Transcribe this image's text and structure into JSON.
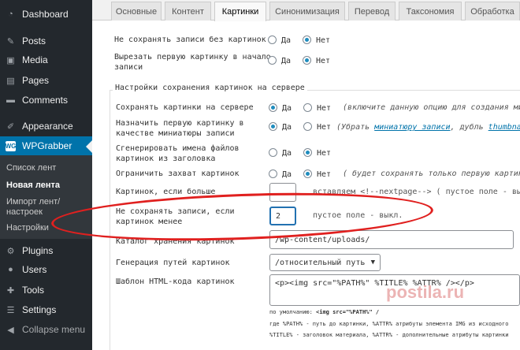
{
  "sidebar": {
    "items": [
      {
        "label": "Dashboard",
        "icon": "dashboard-icon"
      },
      {
        "label": "Posts",
        "icon": "pushpin-icon"
      },
      {
        "label": "Media",
        "icon": "media-icon"
      },
      {
        "label": "Pages",
        "icon": "pages-icon"
      },
      {
        "label": "Comments",
        "icon": "comment-icon"
      },
      {
        "label": "Appearance",
        "icon": "brush-icon"
      },
      {
        "label": "WPGrabber",
        "icon_text": "WG"
      },
      {
        "label": "Plugins",
        "icon": "plugin-icon"
      },
      {
        "label": "Users",
        "icon": "users-icon"
      },
      {
        "label": "Tools",
        "icon": "wrench-icon"
      },
      {
        "label": "Settings",
        "icon": "settings-icon"
      },
      {
        "label": "Collapse menu",
        "icon": "collapse-icon"
      }
    ],
    "submenu": [
      "Список лент",
      "Новая лента",
      "Импорт лент/",
      "настроек",
      "Настройки"
    ]
  },
  "tabs": [
    "Основные",
    "Контент",
    "Картинки",
    "Синонимизация",
    "Перевод",
    "Таксономия",
    "Обработка"
  ],
  "active_tab": "Картинки",
  "radio_labels": {
    "yes": "Да",
    "no": "Нет"
  },
  "top_options": [
    {
      "label": "Не сохранять записи без картинок",
      "value": "Нет"
    },
    {
      "label_1": "Вырезать первую картинку в начало",
      "label_2": "записи",
      "value": "Нет"
    }
  ],
  "section_title": "Настройки сохранения картинок на сервере",
  "server_options": {
    "save": {
      "label": "Сохранять картинки на сервере",
      "value": "Да",
      "note": "(включите данную опцию для создания миниа"
    },
    "thumb": {
      "label_1": "Назначить первую картинку в",
      "label_2": "качестве миниатюры записи",
      "value": "Да",
      "note_prefix": "(Убрать ",
      "note_link": "миниатюру записи",
      "note_mid": ", дубль ",
      "note_link2": "thumbnail"
    },
    "gen_names": {
      "label_1": "Сгенерировать имена файлов",
      "label_2": "картинок из заголовка",
      "value": "Нет"
    },
    "limit": {
      "label": "Ограничить захват картинок",
      "value": "Нет",
      "note": "( будет сохранять только первую картинк"
    }
  },
  "more_than": {
    "label": "Картинок, если больше",
    "value": "",
    "after": "вставляем <!--nextpage--> ( пустое поле - выкл."
  },
  "less_than": {
    "label_1": "Не сохранять записи, если",
    "label_2": "картинок менее",
    "value": "2",
    "after": "пустое поле - выкл."
  },
  "catalog": {
    "label": "Каталог хранения картинок",
    "value": "/wp-content/uploads/"
  },
  "path_gen": {
    "label": "Генерация путей картинок",
    "value": "/относительный путь"
  },
  "template": {
    "label": "Шаблон HTML-кода картинок",
    "value": "<p><img src=\"%PATH%\" %TITLE% %ATTR% /></p>"
  },
  "help": {
    "line1_pre": "по умолчанию: ",
    "line1_code": "<img src=\"%PATH%\" /",
    "line2": "где %PATH% - путь до картинки, %ATTR% атрибуты элемента IMG из исходного",
    "line3": "%TITLE% - заголовок материала, %ATTR% - дополнительные атрибуты картинки"
  },
  "watermark": "postila.ru",
  "colors": {
    "accent": "#0073aa",
    "sidebar": "#23282d",
    "highlight": "#e0201f"
  }
}
